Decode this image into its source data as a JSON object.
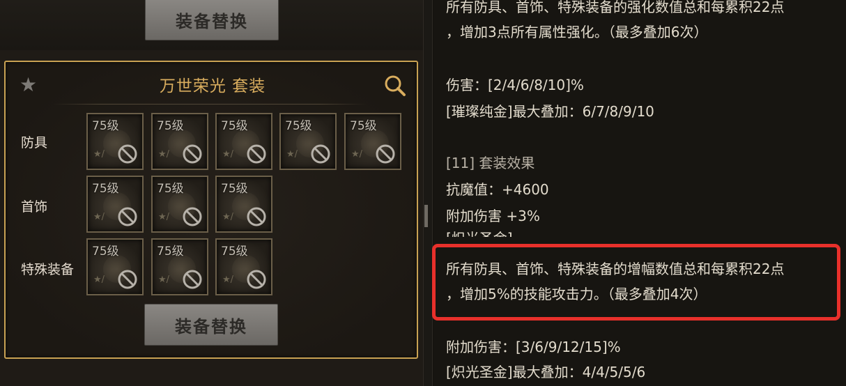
{
  "left": {
    "swap_button_label": "装备替换",
    "set_name": "万世荣光  套装",
    "rows": [
      {
        "label": "防具",
        "slot_count": 5
      },
      {
        "label": "首饰",
        "slot_count": 3
      },
      {
        "label": "特殊装备",
        "slot_count": 3
      }
    ],
    "slot_level": "75级"
  },
  "right": {
    "lines": [
      "所有防具、首饰、特殊装备的强化数值总和每累积22点",
      "，增加3点所有属性强化。（最多叠加6次）",
      "伤害：[2/4/6/8/10]%",
      "[璀璨纯金]最大叠加：6/7/8/9/10",
      "[11] 套装效果",
      "抗魔值：+4600",
      "附加伤害 +3%",
      "[炽光圣金]",
      "所有防具、首饰、特殊装备的增幅数值总和每累积22点",
      "，增加5%的技能攻击力。（最多叠加4次）",
      "附加伤害：[3/6/9/12/15]%",
      "[炽光圣金]最大叠加：4/4/5/5/6"
    ]
  },
  "colors": {
    "gold_frame": "#c9a253",
    "gold_title": "#d9ad5e",
    "highlight_red": "#e8302b",
    "text": "#e3dccd"
  },
  "icons": {
    "star": "star-icon",
    "search": "search-icon",
    "ban": "no-entry-icon"
  }
}
